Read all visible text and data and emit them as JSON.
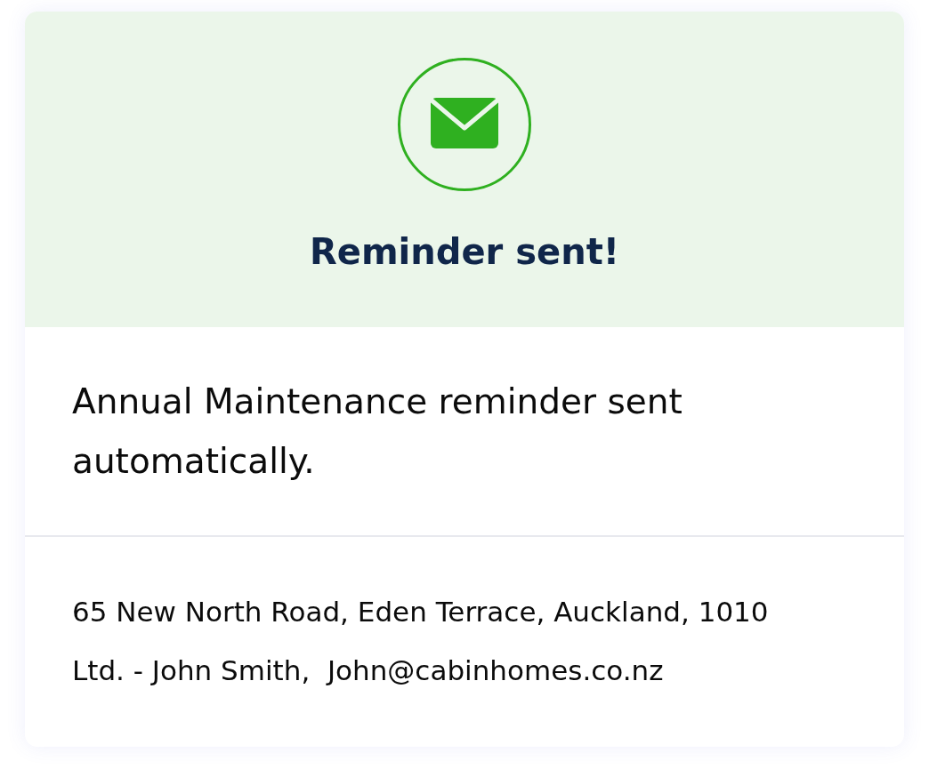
{
  "header": {
    "title": "Reminder sent!"
  },
  "message": "Annual Maintenance reminder sent automatically.",
  "details": [
    "65 New North Road, Eden Terrace, Auckland, 1010",
    "Ltd. - John Smith,  John@cabinhomes.co.nz"
  ]
}
